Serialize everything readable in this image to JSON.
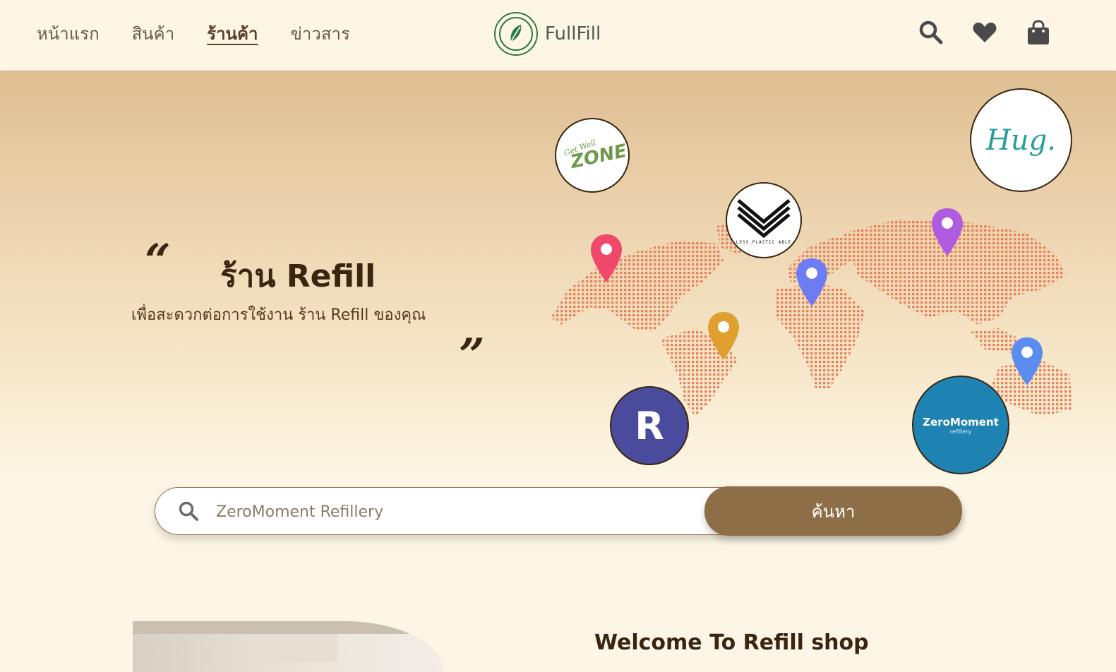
{
  "nav": {
    "items": [
      {
        "label": "หน้าแรก"
      },
      {
        "label": "สินค้า"
      },
      {
        "label": "ร้านค้า"
      },
      {
        "label": "ข่าวสาร"
      }
    ],
    "active_index": 2
  },
  "brand": {
    "name": "FullFill",
    "color": "#2f7a43"
  },
  "header_icons": [
    "search-icon",
    "heart-icon",
    "shopping-bag-icon"
  ],
  "hero": {
    "quote_open": "“",
    "quote_close": "”",
    "title": "ร้าน Refill",
    "subtitle": "เพื่อสะดวกต่อการใช้งาน ร้าน Refill ของคุณ"
  },
  "shops": [
    {
      "name": "Get Well Zone",
      "logo_text": "ZONE",
      "logo_small": "Get Well"
    },
    {
      "name": "Less Plastic Able",
      "logo_text": "LESS PLASTIC ABLE"
    },
    {
      "name": "Hug",
      "logo_text": "Hug."
    },
    {
      "name": "Refill R",
      "logo_text": "R"
    },
    {
      "name": "ZeroMoment Refillery",
      "logo_text": "ZeroMoment",
      "logo_small": "refillery"
    }
  ],
  "pins": [
    {
      "color": "#f0486a"
    },
    {
      "color": "#e0a030"
    },
    {
      "color": "#6d7cf2"
    },
    {
      "color": "#b05ce0"
    },
    {
      "color": "#5b8cf0"
    }
  ],
  "search": {
    "placeholder": "ZeroMoment Refillery",
    "value": "",
    "button_label": "ค้นหา"
  },
  "section": {
    "welcome_title": "Welcome To Refill shop"
  },
  "colors": {
    "accent": "#8e6e47",
    "heading": "#3a2510",
    "map_dots": "#e8825a"
  }
}
